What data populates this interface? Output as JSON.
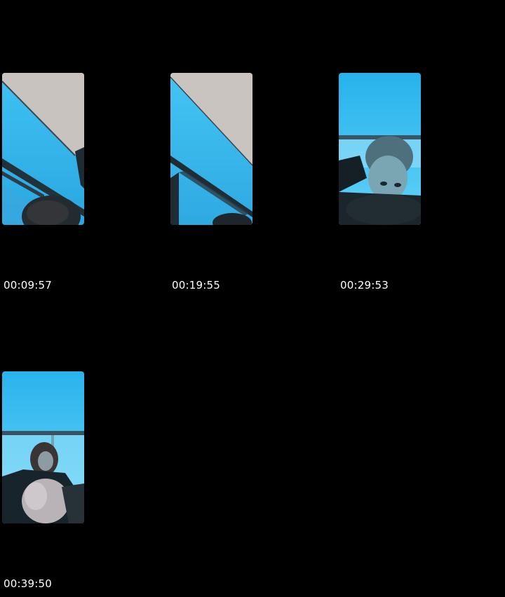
{
  "thumbnails": [
    {
      "timestamp": "00:09:57",
      "scene": "ceiling-window-sky-hair"
    },
    {
      "timestamp": "00:19:55",
      "scene": "ceiling-window-sky"
    },
    {
      "timestamp": "00:29:53",
      "scene": "sky-railing-person-face"
    },
    {
      "timestamp": "00:39:50",
      "scene": "sky-railing-person-sitting"
    }
  ],
  "colors": {
    "background": "#000000",
    "sky": "#33b8ee",
    "sky_light": "#5fd0f8",
    "ceiling": "#c9c4bf",
    "dark": "#1c2a30",
    "text": "#ffffff"
  }
}
